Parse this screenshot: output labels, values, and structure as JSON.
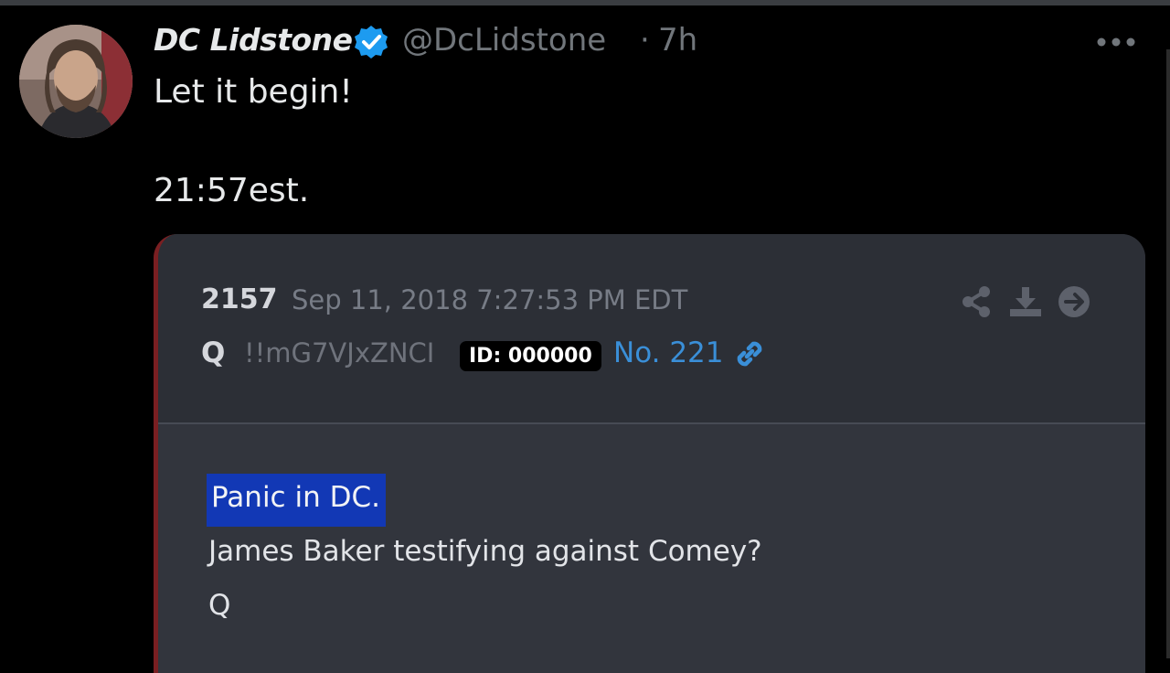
{
  "author": {
    "name": "DC Lidstone",
    "handle": "@DcLidstone",
    "separator": "·",
    "time": "7h"
  },
  "tweet": {
    "line1": "Let it begin!",
    "line2": "21:57est."
  },
  "quoted_post": {
    "number": "2157",
    "date": "Sep 11, 2018 7:27:53 PM EDT",
    "author_initial": "Q",
    "tripcode": "!!mG7VJxZNCI",
    "id_badge": "ID: 000000",
    "post_no": "No. 221",
    "body": {
      "line1": "Panic in DC.",
      "line2": "James Baker testifying against Comey?",
      "line3": "Q"
    }
  },
  "icons": {
    "verified": "verified-badge-icon",
    "more": "more-options-icon",
    "link": "link-icon",
    "share": "share-icon",
    "download": "download-icon",
    "arrow": "arrow-right-circle-icon"
  },
  "colors": {
    "verified_blue": "#1d9bf0",
    "link_blue": "#3a8fd8",
    "highlight_blue": "#1238b5"
  }
}
